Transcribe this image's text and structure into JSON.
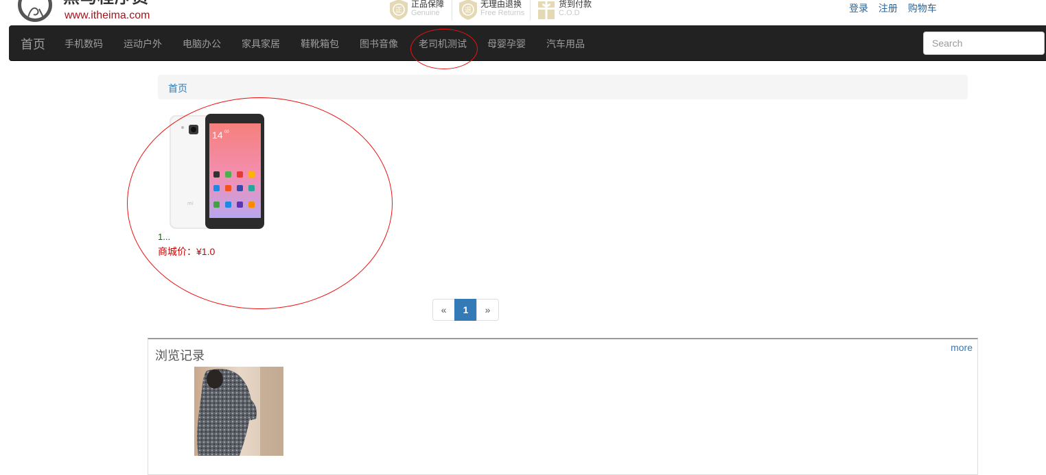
{
  "header": {
    "logo_text": "黑马程序员",
    "logo_url": "www.itheima.com",
    "promos": [
      {
        "title": "正品保障",
        "subtitle": "Genuine",
        "icon": "genuine-badge-icon"
      },
      {
        "title": "无理由退换",
        "subtitle": "Free Returns",
        "icon": "return-badge-icon"
      },
      {
        "title": "货到付款",
        "subtitle": "C.O.D",
        "icon": "gift-badge-icon"
      }
    ],
    "links": {
      "login": "登录",
      "register": "注册",
      "cart": "购物车"
    }
  },
  "navbar": {
    "brand": "首页",
    "items": [
      "手机数码",
      "运动户外",
      "电脑办公",
      "家具家居",
      "鞋靴箱包",
      "图书音像",
      "老司机测试",
      "母婴孕婴",
      "汽车用品"
    ],
    "search_placeholder": "Search"
  },
  "breadcrumb": {
    "home": "首页"
  },
  "products": [
    {
      "name": "1...",
      "price_label": "商城价：",
      "price": "¥1.0",
      "image": "white-smartphone-photo"
    }
  ],
  "pagination": {
    "prev": "«",
    "pages": [
      "1"
    ],
    "current": "1",
    "next": "»"
  },
  "history": {
    "title": "浏览记录",
    "more": "more",
    "items": [
      {
        "image": "knit-sweater-photo"
      }
    ]
  },
  "colors": {
    "navbar_bg": "#222222",
    "link": "#337ab7",
    "price": "#cc0000",
    "annotation": "#ee1111"
  }
}
